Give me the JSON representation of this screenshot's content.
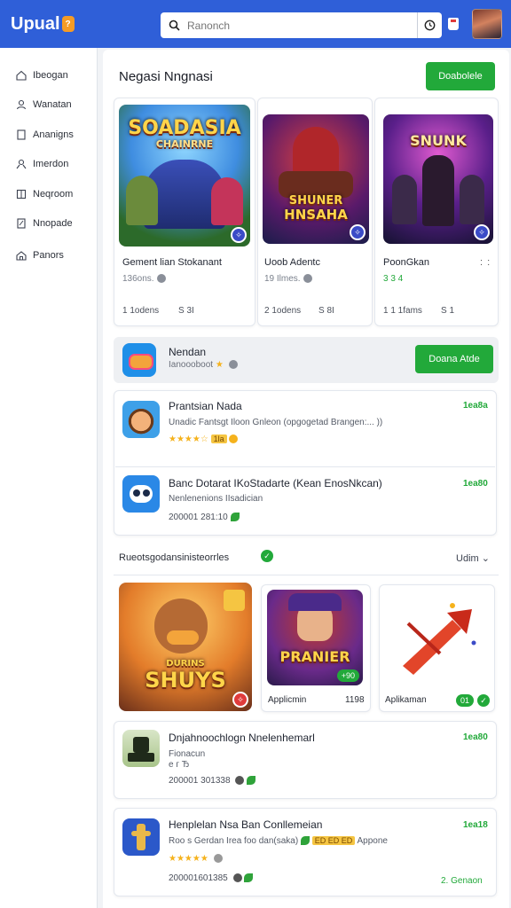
{
  "header": {
    "logo_text": "Upual",
    "logo_badge": "?",
    "search_placeholder": "Ranonch"
  },
  "sidebar": {
    "items": [
      {
        "label": "Ibeogan",
        "icon": "home-icon"
      },
      {
        "label": "Wanatan",
        "icon": "people-icon"
      },
      {
        "label": "Ananigns",
        "icon": "book-icon"
      },
      {
        "label": "Imerdon",
        "icon": "user-icon"
      },
      {
        "label": "Neqroom",
        "icon": "grid-icon"
      },
      {
        "label": "Nnopade",
        "icon": "edit-icon"
      },
      {
        "label": "Panors",
        "icon": "house-icon"
      }
    ]
  },
  "featured": {
    "title": "Negasi Nngnasi",
    "button": "Doabolele",
    "cards": [
      {
        "art_title": "SOADASIA",
        "art_subtitle": "CHAINRNE",
        "name": "Gement lian Stokanant",
        "sub": "136ons.",
        "meta_left": "1  1odens",
        "meta_right": "S 3I"
      },
      {
        "art_title": "SHUNER",
        "art_subtitle": "HNSAHA",
        "name": "Uoob Adentc",
        "sub": "19 Ilmes.",
        "meta_left": "2  1odens",
        "meta_right": "S 8I"
      },
      {
        "art_title": "SNUNK",
        "art_subtitle": "",
        "name": "PoonGkan",
        "sub": "3 3 4",
        "meta_left": "1 1 1fams",
        "meta_right": "S 1"
      }
    ]
  },
  "promo": {
    "name": "Nendan",
    "sub": "Ianoooboot",
    "button": "Doana Atde"
  },
  "list1": [
    {
      "title": "Prantsian Nada",
      "desc": "Unadic Fantsgt Iloon Gnleon (opgogetad Brangen:... ))",
      "chip": "1la",
      "size": "1ea8a"
    },
    {
      "title": "Banc Dotarat IKoStadarte (Kean EnosNkcan)",
      "desc": "Nenlenenions IIsadician",
      "meta": "200001 281:10",
      "size": "1ea80"
    }
  ],
  "section": {
    "label": "Rueotsgodansinisteorrles",
    "more": "Udim"
  },
  "second_cards": [
    {
      "art_title": "SHUYS",
      "art_subtitle": "DURINS"
    },
    {
      "art_title": "PRANIER",
      "label": "Applicmin",
      "count": "1198",
      "pill": "+90"
    },
    {
      "label": "Aplikaman",
      "pill": "01"
    }
  ],
  "list2": [
    {
      "title": "Dnjahnoochlogn Nnelenhemarl",
      "desc": "Fionacun",
      "desc2": "e г Ђ",
      "meta": "200001 301338",
      "size": "1ea80"
    },
    {
      "title": "Henplelan Nsa Ban Conllemeian",
      "desc": "Roo s Gerdan Irea foo dan(saka)",
      "chip": "ED ED ED",
      "desc_tail": "Appone",
      "meta": "200001601385",
      "size": "1ea18",
      "link": "2. Genaon"
    }
  ],
  "colors": {
    "header_blue": "#2f5fd8",
    "accent_green": "#22a93a",
    "star_gold": "#f5b21c"
  }
}
